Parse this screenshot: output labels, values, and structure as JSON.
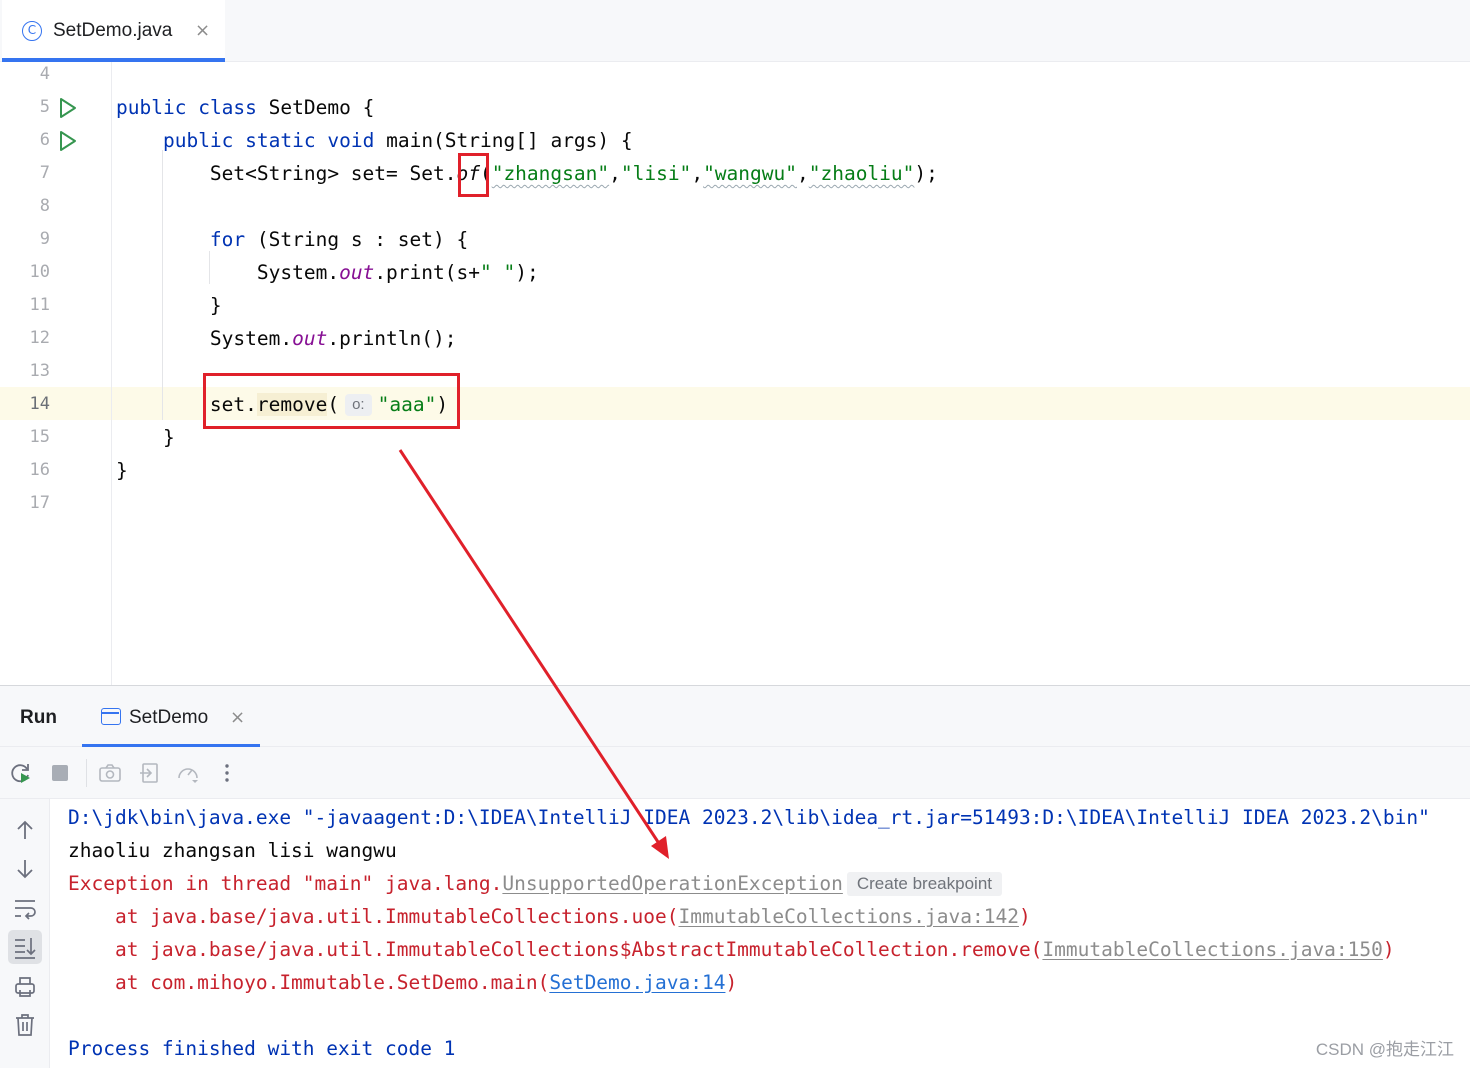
{
  "editor_tab": {
    "icon": "C",
    "label": "SetDemo.java",
    "close": "×"
  },
  "line_numbers": [
    "4",
    "5",
    "6",
    "7",
    "8",
    "9",
    "10",
    "11",
    "12",
    "13",
    "14",
    "15",
    "16",
    "17"
  ],
  "code": {
    "l5": {
      "kw1": "public",
      "kw2": "class",
      "rest": "SetDemo {"
    },
    "l6": {
      "kw1": "public",
      "kw2": "static",
      "kw3": "void",
      "rest": "main(String[] args) {"
    },
    "l7": {
      "a": "Set<String> set= Set.",
      "of": "of",
      "b": "(",
      "s1": "\"zhangsan\"",
      "c1": ",",
      "s2": "\"lisi\"",
      "c2": ",",
      "s3": "\"wangwu\"",
      "c3": ",",
      "s4": "\"zhaoliu\"",
      "end": ");"
    },
    "l9": {
      "kw": "for",
      "rest": " (String s : set) {"
    },
    "l10": {
      "a": "System.",
      "fld": "out",
      "b": ".print(s+",
      "str": "\" \"",
      "end": ");"
    },
    "l11": "}",
    "l12": {
      "a": "System.",
      "fld": "out",
      "b": ".println();"
    },
    "l14": {
      "a": "set.",
      "method": "remove",
      "b": "(",
      "hint": "o:",
      "str": "\"aaa\"",
      "end": ")"
    },
    "l15": "}",
    "l16": "}"
  },
  "run_panel": {
    "title": "Run",
    "tab_label": "SetDemo",
    "tab_close": "×"
  },
  "console": {
    "line1": "D:\\jdk\\bin\\java.exe \"-javaagent:D:\\IDEA\\IntelliJ IDEA 2023.2\\lib\\idea_rt.jar=51493:D:\\IDEA\\IntelliJ IDEA 2023.2\\bin\"",
    "line2": "zhaoliu zhangsan lisi wangwu",
    "line3_prefix": "Exception in thread \"main\" java.lang.",
    "line3_link": "UnsupportedOperationException",
    "line3_hint": "Create breakpoint",
    "line4_prefix": "    at java.base/java.util.ImmutableCollections.uoe(",
    "line4_link": "ImmutableCollections.java:142",
    "line4_end": ")",
    "line5_prefix": "    at java.base/java.util.ImmutableCollections$AbstractImmutableCollection.remove(",
    "line5_link": "ImmutableCollections.java:150",
    "line5_end": ")",
    "line6_prefix": "    at com.mihoyo.Immutable.SetDemo.main(",
    "line6_link": "SetDemo.java:14",
    "line6_end": ")",
    "line8": "Process finished with exit code 1"
  },
  "watermark": "CSDN @抱走江江",
  "colors": {
    "accent": "#3574f0",
    "keyword": "#0033b3",
    "string": "#067d17",
    "error": "#c7222d",
    "annotation": "#e0202a"
  }
}
